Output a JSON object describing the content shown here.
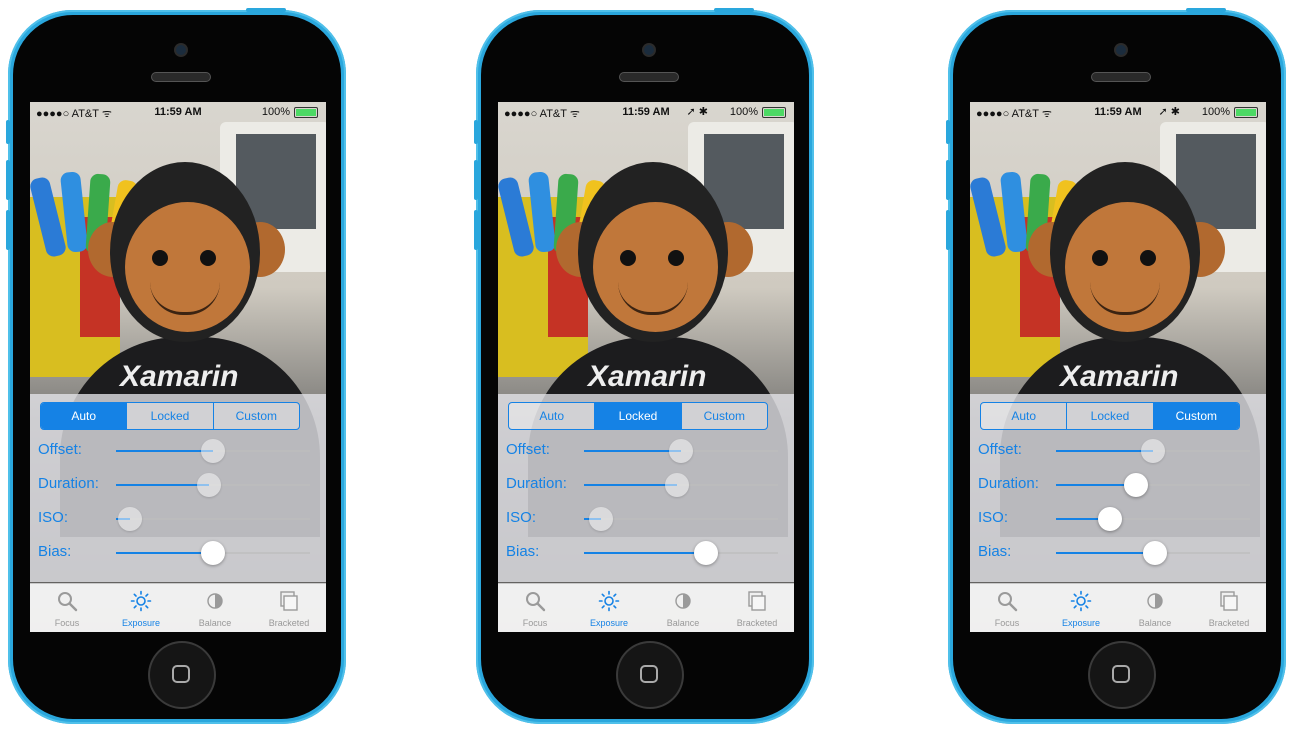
{
  "phones": [
    {
      "status": {
        "carrier": "●●●●○ AT&T ᯤ",
        "time": "11:59 AM",
        "battery": "100%",
        "extra_icons": ""
      },
      "photo_text": "Xamarin",
      "segments": [
        {
          "label": "Auto",
          "selected": true
        },
        {
          "label": "Locked",
          "selected": false
        },
        {
          "label": "Custom",
          "selected": false
        }
      ],
      "sliders": [
        {
          "label": "Offset:",
          "value": 0.5,
          "enabled": false
        },
        {
          "label": "Duration:",
          "value": 0.48,
          "enabled": false
        },
        {
          "label": "ISO:",
          "value": 0.07,
          "enabled": false
        },
        {
          "label": "Bias:",
          "value": 0.5,
          "enabled": true
        }
      ],
      "tabs": [
        {
          "label": "Focus",
          "icon": "magnifier-icon",
          "active": false
        },
        {
          "label": "Exposure",
          "icon": "sun-icon",
          "active": true
        },
        {
          "label": "Balance",
          "icon": "half-circle-icon",
          "active": false
        },
        {
          "label": "Bracketed",
          "icon": "stacked-frames-icon",
          "active": false
        }
      ]
    },
    {
      "status": {
        "carrier": "●●●●○ AT&T ᯤ",
        "time": "11:59 AM",
        "battery": "100%",
        "extra_icons": "➚ ✱"
      },
      "photo_text": "Xamarin",
      "segments": [
        {
          "label": "Auto",
          "selected": false
        },
        {
          "label": "Locked",
          "selected": true
        },
        {
          "label": "Custom",
          "selected": false
        }
      ],
      "sliders": [
        {
          "label": "Offset:",
          "value": 0.5,
          "enabled": false
        },
        {
          "label": "Duration:",
          "value": 0.48,
          "enabled": false
        },
        {
          "label": "ISO:",
          "value": 0.09,
          "enabled": false
        },
        {
          "label": "Bias:",
          "value": 0.63,
          "enabled": true
        }
      ],
      "tabs": [
        {
          "label": "Focus",
          "icon": "magnifier-icon",
          "active": false
        },
        {
          "label": "Exposure",
          "icon": "sun-icon",
          "active": true
        },
        {
          "label": "Balance",
          "icon": "half-circle-icon",
          "active": false
        },
        {
          "label": "Bracketed",
          "icon": "stacked-frames-icon",
          "active": false
        }
      ]
    },
    {
      "status": {
        "carrier": "●●●●○ AT&T ᯤ",
        "time": "11:59 AM",
        "battery": "100%",
        "extra_icons": "➚ ✱"
      },
      "photo_text": "Xamarin",
      "segments": [
        {
          "label": "Auto",
          "selected": false
        },
        {
          "label": "Locked",
          "selected": false
        },
        {
          "label": "Custom",
          "selected": true
        }
      ],
      "sliders": [
        {
          "label": "Offset:",
          "value": 0.5,
          "enabled": false
        },
        {
          "label": "Duration:",
          "value": 0.41,
          "enabled": true
        },
        {
          "label": "ISO:",
          "value": 0.28,
          "enabled": true
        },
        {
          "label": "Bias:",
          "value": 0.51,
          "enabled": true
        }
      ],
      "tabs": [
        {
          "label": "Focus",
          "icon": "magnifier-icon",
          "active": false
        },
        {
          "label": "Exposure",
          "icon": "sun-icon",
          "active": true
        },
        {
          "label": "Balance",
          "icon": "half-circle-icon",
          "active": false
        },
        {
          "label": "Bracketed",
          "icon": "stacked-frames-icon",
          "active": false
        }
      ]
    }
  ],
  "colors": {
    "accent": "#1582e5",
    "phone_shell": "#2aa7dd",
    "battery_green": "#4cd964"
  }
}
